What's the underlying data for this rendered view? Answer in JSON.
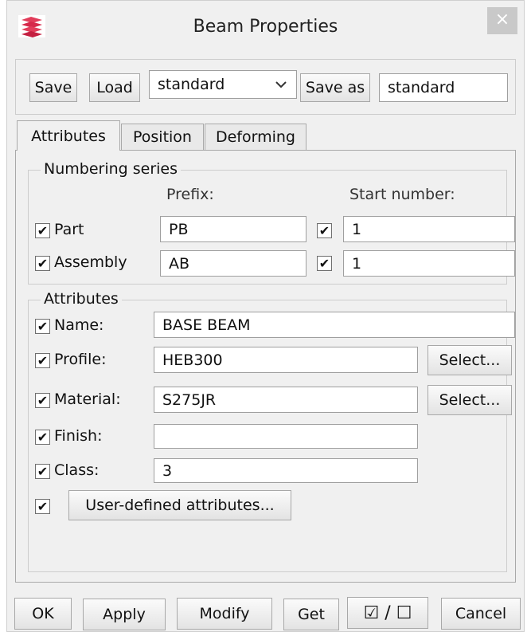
{
  "window": {
    "title": "Beam Properties",
    "close_label": "×",
    "icon": "app-logo-icon"
  },
  "toolbar": {
    "save_label": "Save",
    "load_label": "Load",
    "preset_selected": "standard",
    "dropdown_icon": "chevron-down-icon",
    "save_as_label": "Save as",
    "save_as_value": "standard"
  },
  "tabs": [
    {
      "label": "Attributes",
      "active": true
    },
    {
      "label": "Position",
      "active": false
    },
    {
      "label": "Deforming",
      "active": false
    }
  ],
  "numbering": {
    "title": "Numbering series",
    "prefix_header": "Prefix:",
    "start_header": "Start number:",
    "rows": [
      {
        "label": "Part",
        "checked": true,
        "prefix": "PB",
        "start_checked": true,
        "start": "1"
      },
      {
        "label": "Assembly",
        "checked": true,
        "prefix": "AB",
        "start_checked": true,
        "start": "1"
      }
    ]
  },
  "attributes": {
    "title": "Attributes",
    "name": {
      "label": "Name:",
      "value": "BASE BEAM",
      "checked": true
    },
    "profile": {
      "label": "Profile:",
      "value": "HEB300",
      "checked": true,
      "button": "Select..."
    },
    "material": {
      "label": "Material:",
      "value": "S275JR",
      "checked": true,
      "button": "Select..."
    },
    "finish": {
      "label": "Finish:",
      "value": "",
      "checked": true
    },
    "class": {
      "label": "Class:",
      "value": "3",
      "checked": true
    },
    "udf": {
      "label": "User-defined attributes...",
      "checked": true
    }
  },
  "footer": {
    "ok": "OK",
    "apply": "Apply",
    "modify": "Modify",
    "get": "Get",
    "toggle_all": "☑ / ☐",
    "cancel": "Cancel"
  },
  "check_mark": "✔"
}
